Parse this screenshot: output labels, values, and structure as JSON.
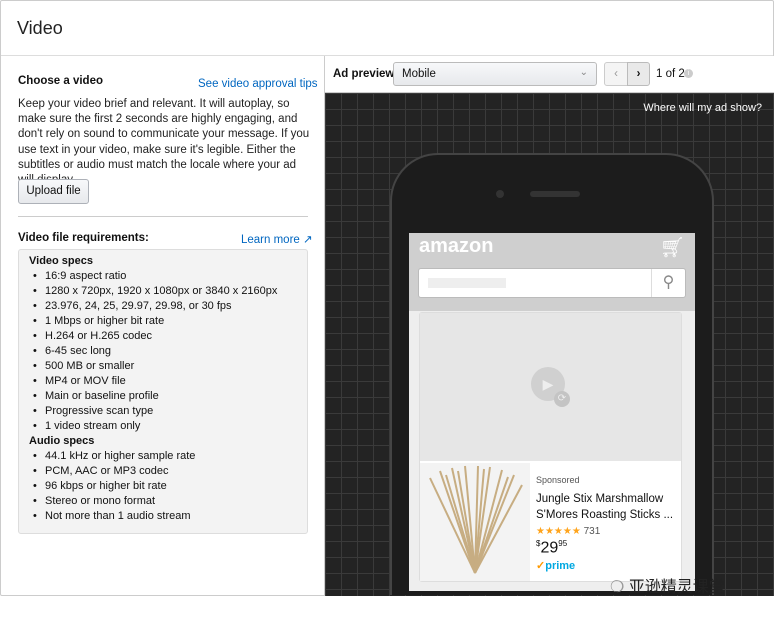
{
  "header": {
    "title": "Video"
  },
  "left": {
    "choose_title": "Choose a video",
    "approval_link": "See video approval tips",
    "description": "Keep your video brief and relevant. It will autoplay, so make sure the first 2 seconds are highly engaging, and don't rely on sound to communicate your message. If you use text in your video, make sure it's legible. Either the subtitles or audio must match the locale where your ad will display.",
    "upload_label": "Upload file",
    "requirements_title": "Video file requirements:",
    "learn_more": "Learn more",
    "video_specs_title": "Video specs",
    "video_specs": [
      "16:9 aspect ratio",
      "1280 x 720px, 1920 x 1080px or 3840 x 2160px",
      "23.976, 24, 25, 29.97, 29.98, or 30 fps",
      "1 Mbps or higher bit rate",
      "H.264 or H.265 codec",
      "6-45 sec long",
      "500 MB or smaller",
      "MP4 or MOV file",
      "Main or baseline profile",
      "Progressive scan type",
      "1 video stream only"
    ],
    "audio_specs_title": "Audio specs",
    "audio_specs": [
      "44.1 kHz or higher sample rate",
      "PCM, AAC or MP3 codec",
      "96 kbps or higher bit rate",
      "Stereo or mono format",
      "Not more than 1 audio stream"
    ]
  },
  "preview": {
    "label": "Ad preview",
    "device": "Mobile",
    "pager": "1 of 2",
    "where_link": "Where will my ad show?",
    "logo": "amazon",
    "product": {
      "sponsored": "Sponsored",
      "title1": "Jungle Stix Marshmallow",
      "title2": "S'Mores Roasting Sticks ...",
      "rating": 4.5,
      "reviews": "731",
      "price_dollar": "$",
      "price_whole": "29",
      "price_cents": "95",
      "prime": "prime"
    }
  },
  "watermark": "亚逊精灵课堂",
  "colors": {
    "link": "#0066c0",
    "star": "#ffa41c",
    "prime": "#00a8e1"
  }
}
